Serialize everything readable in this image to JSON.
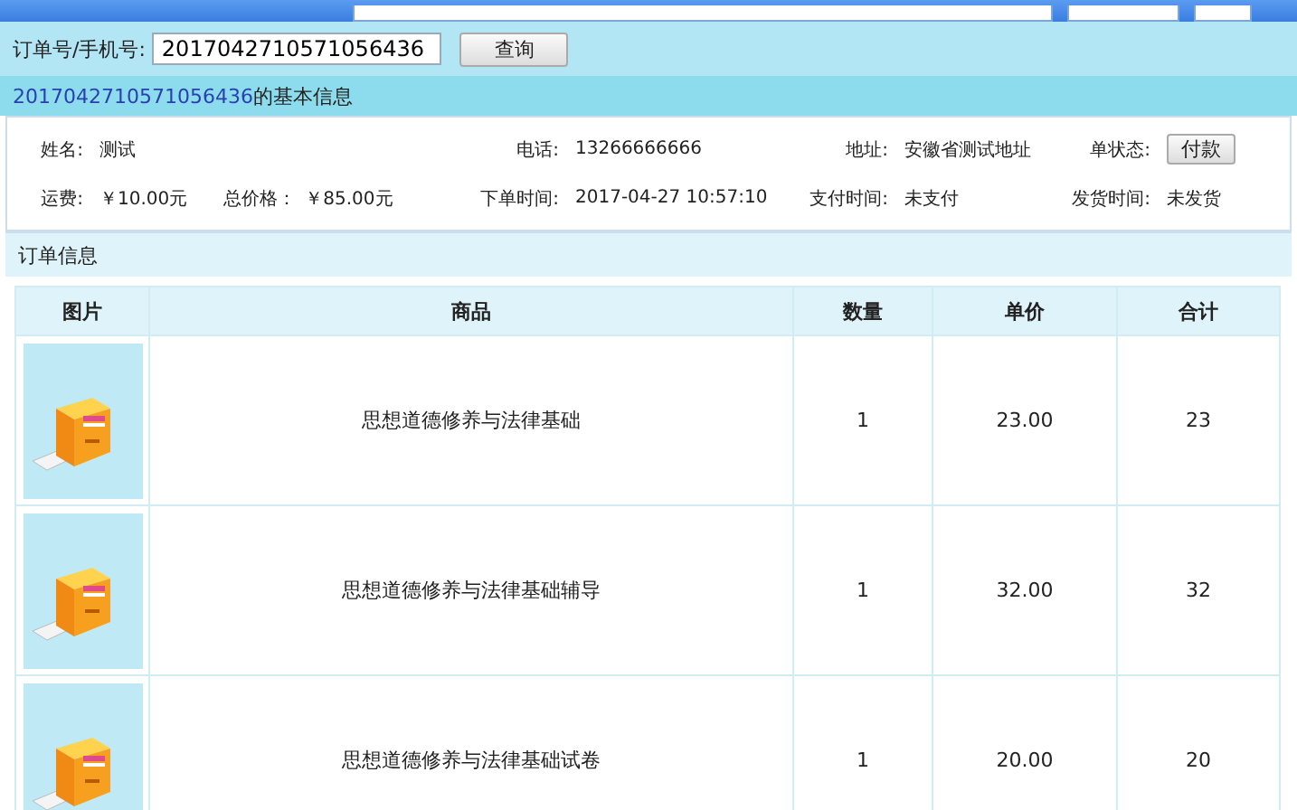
{
  "search": {
    "label": "订单号/手机号:",
    "value": "2017042710571056436",
    "button": "查询"
  },
  "info_title": {
    "order_no": "2017042710571056436",
    "suffix": "的基本信息"
  },
  "info_rows": [
    {
      "cells": [
        {
          "pairs": [
            {
              "label": "姓名:",
              "value": "测试",
              "kind": "text"
            }
          ]
        },
        {
          "pairs": [
            {
              "label": "电话:",
              "value": "13266666666",
              "kind": "text"
            }
          ]
        },
        {
          "pairs": [
            {
              "label": "地址:",
              "value": "安徽省测试地址",
              "kind": "text"
            }
          ]
        },
        {
          "pairs": [
            {
              "label": "单状态:",
              "value": "付款",
              "kind": "button"
            }
          ]
        }
      ]
    },
    {
      "cells": [
        {
          "pairs": [
            {
              "label": "运费:",
              "value": "￥10.00元",
              "kind": "text"
            },
            {
              "label": "总价格：",
              "value": "￥85.00元",
              "kind": "text"
            }
          ]
        },
        {
          "pairs": [
            {
              "label": "下单时间:",
              "value": "2017-04-27 10:57:10",
              "kind": "text"
            }
          ]
        },
        {
          "pairs": [
            {
              "label": "支付时间:",
              "value": "未支付",
              "kind": "text"
            }
          ]
        },
        {
          "pairs": [
            {
              "label": "发货时间:",
              "value": "未发货",
              "kind": "text"
            }
          ]
        }
      ]
    }
  ],
  "section_title": "订单信息",
  "table": {
    "columns": [
      "图片",
      "商品",
      "数量",
      "单价",
      "合计"
    ],
    "rows": [
      {
        "name": "思想道德修养与法律基础",
        "quantity": "1",
        "price": "23.00",
        "total": "23"
      },
      {
        "name": "思想道德修养与法律基础辅导",
        "quantity": "1",
        "price": "32.00",
        "total": "32"
      },
      {
        "name": "思想道德修养与法律基础试卷",
        "quantity": "1",
        "price": "20.00",
        "total": "20"
      }
    ]
  }
}
